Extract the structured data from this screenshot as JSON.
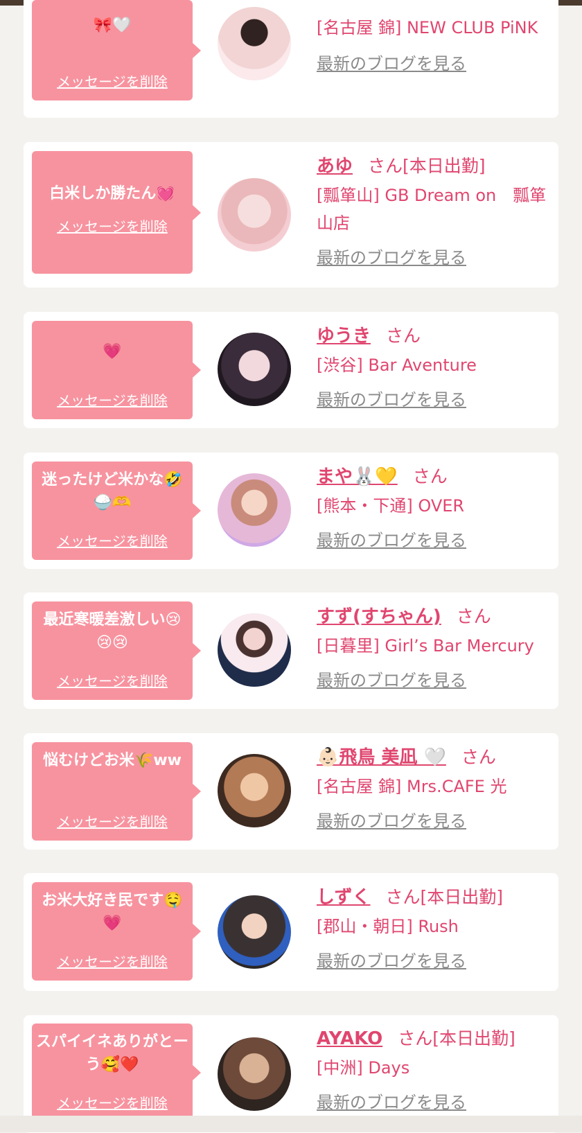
{
  "cards": [
    {
      "message": "🎀🤍",
      "delete": "メッセージを削除",
      "name": "",
      "san": "",
      "status": "",
      "shop": "[名古屋 錦] NEW CLUB PiNK",
      "blog": "最新のブログを見る",
      "avatar_colors": [
        "#f3d7dd",
        "#3b2a28"
      ]
    },
    {
      "message": "白米しか勝たん💓",
      "delete": "メッセージを削除",
      "name": "あゆ",
      "san": "さん",
      "status": "[本日出勤]",
      "shop": "[瓢箪山] GB Dream on　瓢箪山店",
      "blog": "最新のブログを見る",
      "avatar_colors": [
        "#f4c9cf",
        "#e9b8a6"
      ]
    },
    {
      "message": "💗",
      "delete": "メッセージを削除",
      "name": "ゆうき",
      "san": "さん",
      "status": "",
      "shop": "[渋谷] Bar Aventure",
      "blog": "最新のブログを見る",
      "avatar_colors": [
        "#2e2530",
        "#d6b3c9"
      ]
    },
    {
      "message": "迷ったけど米かな🤣🍚🫶",
      "delete": "メッセージを削除",
      "name": "まや🐰💛",
      "san": "さん",
      "status": "",
      "shop": "[熊本・下通] OVER",
      "blog": "最新のブログを見る",
      "avatar_colors": [
        "#d9b8e8",
        "#f3c3d3"
      ]
    },
    {
      "message": "最近寒暖差激しい😢😢😢",
      "delete": "メッセージを削除",
      "name": "すず(すちゃん)",
      "san": "さん",
      "status": "",
      "shop": "[日暮里] Girl’s Bar Mercury",
      "blog": "最新のブログを見る",
      "avatar_colors": [
        "#f6e6ea",
        "#1f2c4a"
      ]
    },
    {
      "message": "悩むけどお米🌾ww",
      "delete": "メッセージを削除",
      "name": "👶🏻飛鳥 美凪 🤍",
      "san": "さん",
      "status": "",
      "shop": "[名古屋 錦] Mrs.CAFE 光",
      "blog": "最新のブログを見る",
      "avatar_colors": [
        "#5a3b2b",
        "#e4b78e"
      ]
    },
    {
      "message": "お米大好き民です🤤💗",
      "delete": "メッセージを削除",
      "name": "しずく",
      "san": "さん",
      "status": "[本日出勤]",
      "shop": "[郡山・朝日] Rush",
      "blog": "最新のブログを見る",
      "avatar_colors": [
        "#3a3636",
        "#2f5fbf"
      ]
    },
    {
      "message": "スパイイネありがとーう🥰❤️",
      "delete": "メッセージを削除",
      "name": "AYAKO",
      "san": "さん",
      "status": "[本日出勤]",
      "shop": "[中洲] Days",
      "blog": "最新のブログを見る",
      "avatar_colors": [
        "#caa588",
        "#2e2420"
      ]
    }
  ]
}
